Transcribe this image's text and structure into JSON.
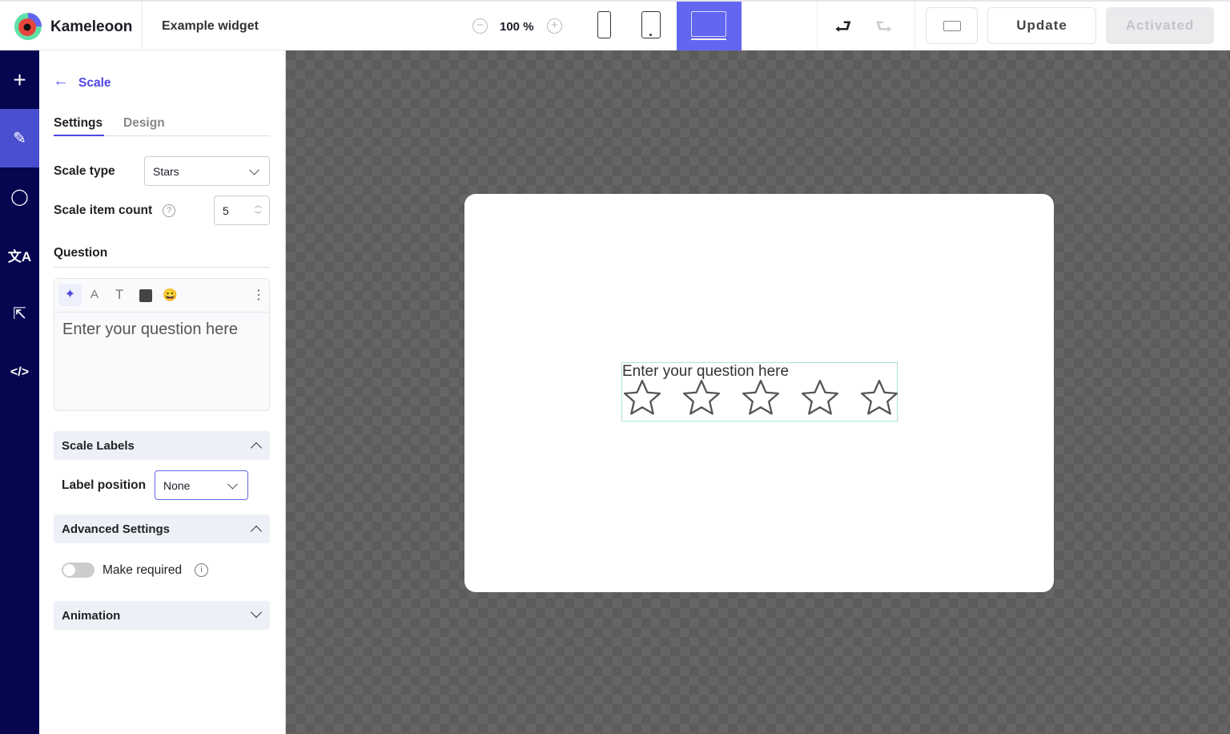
{
  "header": {
    "brand": "Kameleoon",
    "widget_name": "Example widget",
    "zoom": "100 %",
    "update_label": "Update",
    "activated_label": "Activated",
    "active_device": "desktop"
  },
  "colors": {
    "accent": "#6366f1",
    "rail": "#050550",
    "rail_active": "#4a4fcf",
    "widget_outline": "#a8e6cf"
  },
  "panel": {
    "back_label": "Scale",
    "tabs": [
      {
        "label": "Settings",
        "active": true
      },
      {
        "label": "Design",
        "active": false
      }
    ],
    "scale_type_label": "Scale type",
    "scale_type_value": "Stars",
    "item_count_label": "Scale item count",
    "item_count_value": "5",
    "question_label": "Question",
    "question_text": "Enter your question here",
    "scale_labels_section": "Scale Labels",
    "label_position_label": "Label position",
    "label_position_value": "None",
    "advanced_section": "Advanced Settings",
    "make_required_label": "Make required",
    "make_required_on": false,
    "animation_section": "Animation"
  },
  "preview": {
    "question": "Enter your question here",
    "star_count": 5
  }
}
